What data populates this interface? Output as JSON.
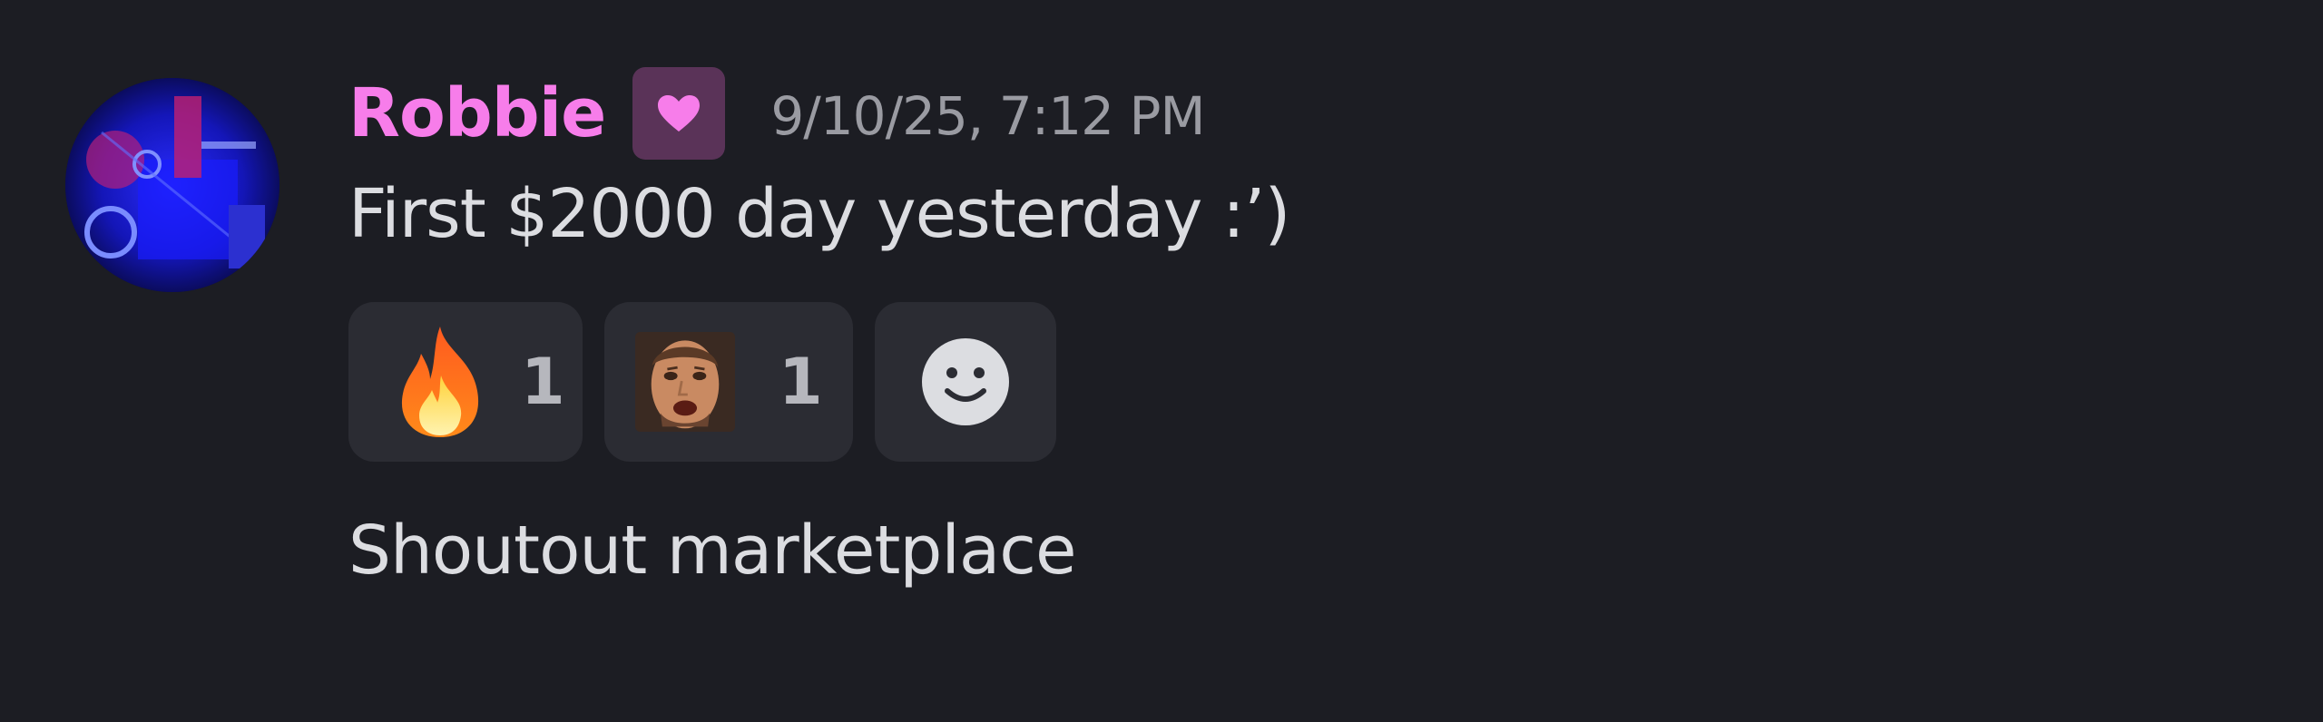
{
  "message": {
    "author": {
      "username": "Robbie",
      "name_color": "#f77dea",
      "role_badge_icon": "heart-icon"
    },
    "timestamp": "9/10/25, 7:12 PM",
    "content": "First $2000 day yesterday :’)",
    "reactions": [
      {
        "emoji": "fire-emoji",
        "count": "1"
      },
      {
        "emoji": "custom-face-emoji",
        "count": "1"
      }
    ],
    "add_reaction_icon": "smiley-icon",
    "followup_content": "Shoutout marketplace"
  },
  "colors": {
    "background": "#1c1d23",
    "reaction_bg": "#2b2c33",
    "badge_bg": "#5a3358"
  }
}
